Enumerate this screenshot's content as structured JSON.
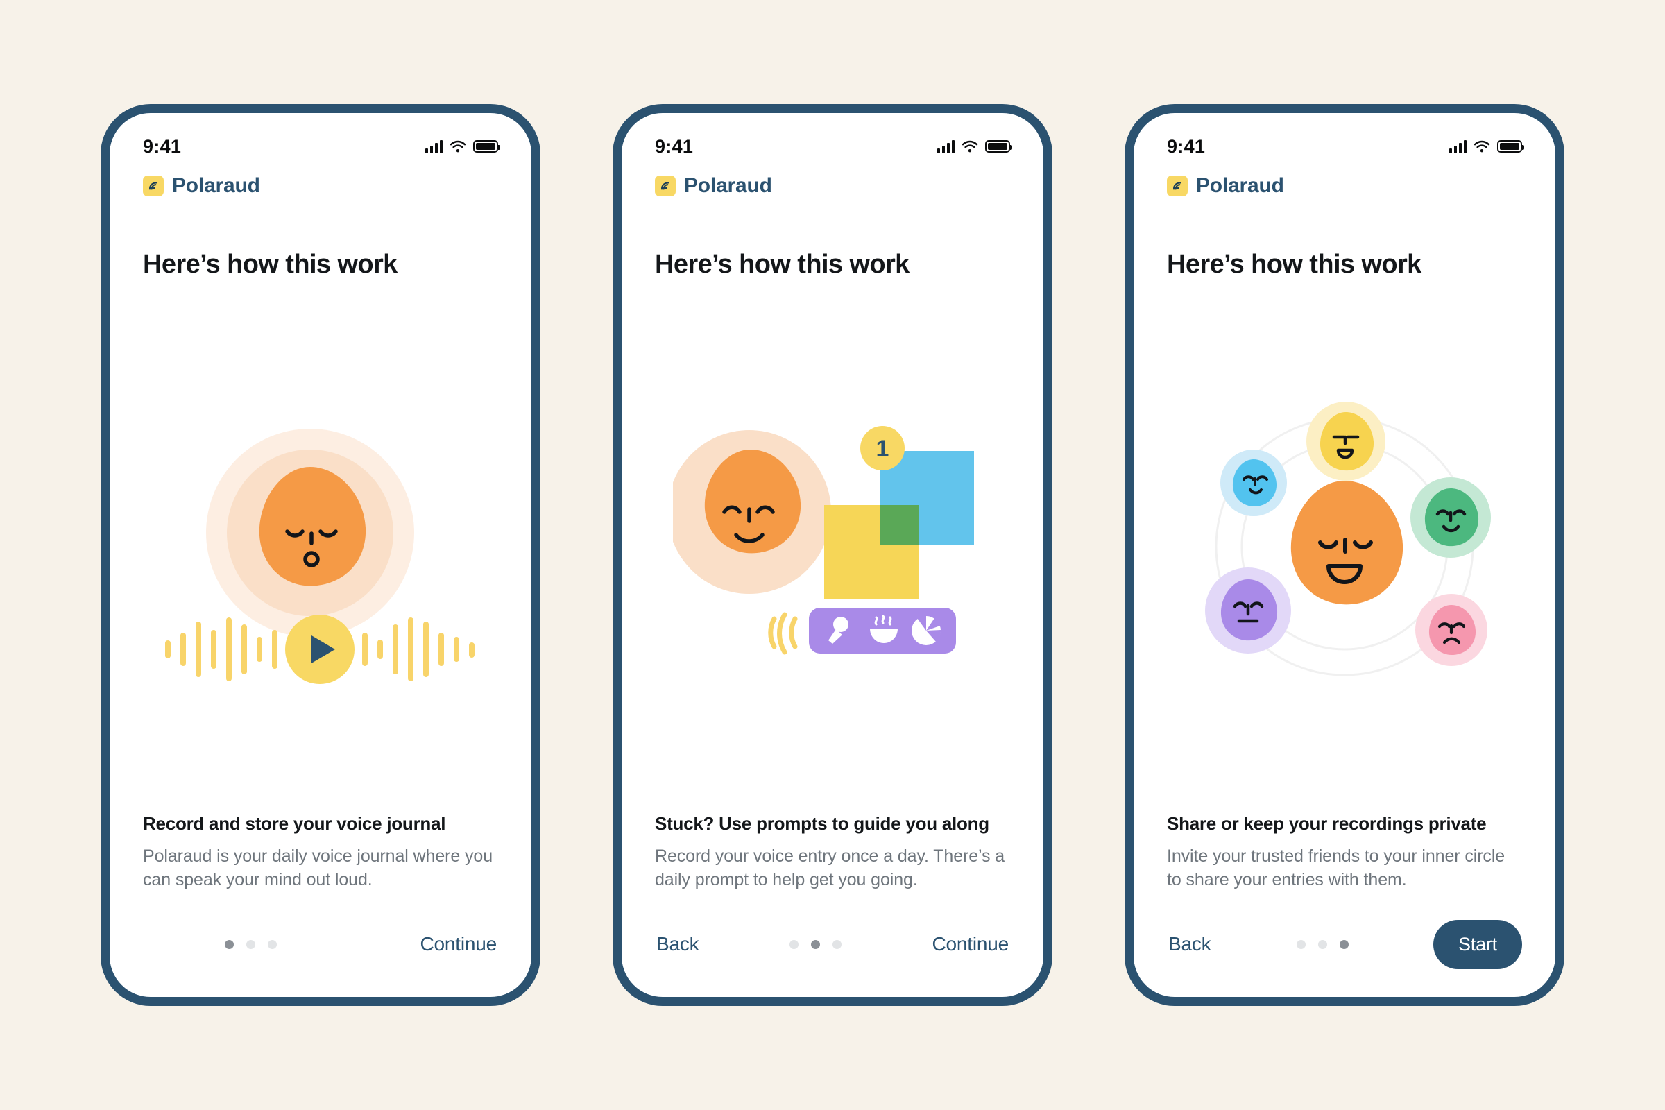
{
  "page": {
    "background_color": "#f7f2e9",
    "phone_frame_color": "#2b5270"
  },
  "status_bar": {
    "time": "9:41",
    "signal_icon": "cellular-signal-icon",
    "wifi_icon": "wifi-icon",
    "battery_icon": "battery-full-icon"
  },
  "brand": {
    "name": "Polaraud",
    "logo_icon": "polaraud-wave-logo-icon",
    "logo_bg_color": "#f8d864",
    "name_color": "#2b5270"
  },
  "screens": [
    {
      "headline": "Here’s how this work",
      "caption_title": "Record and store your voice journal",
      "caption_body": "Polaraud is your daily voice journal where you can speak your mind out loud.",
      "illustration": "voice-journal-play-illustration",
      "back_label": "",
      "next_label": "Continue",
      "next_style": "link",
      "active_dot": 0,
      "dot_count": 3
    },
    {
      "headline": "Here’s how this work",
      "caption_title": "Stuck? Use prompts to guide you along",
      "caption_body": "Record your voice entry once a day. There’s a daily prompt to help get you going.",
      "illustration": "daily-prompt-cards-illustration",
      "back_label": "Back",
      "next_label": "Continue",
      "next_style": "link",
      "active_dot": 1,
      "dot_count": 3,
      "badge_number": "1",
      "prompt_icons": [
        "microphone-icon",
        "steaming-bowl-icon",
        "beach-ball-icon"
      ]
    },
    {
      "headline": "Here’s how this work",
      "caption_title": "Share or keep your recordings private",
      "caption_body": "Invite your trusted friends to your inner circle to share your entries with them.",
      "illustration": "inner-circle-friends-illustration",
      "back_label": "Back",
      "next_label": "Start",
      "next_style": "filled",
      "active_dot": 2,
      "dot_count": 3
    }
  ],
  "colors": {
    "orange_blob": "#f59a46",
    "halo_outer": "#fdeee2",
    "halo_inner": "#fadfc8",
    "yellow": "#f8d864",
    "play_triangle": "#2b5270",
    "waveform": "#f8d46a",
    "card_yellow": "#f6d657",
    "card_blue": "#62c4ec",
    "card_overlap_green": "#5aa857",
    "pill_purple": "#a98ae8",
    "friend_yellow": "#f7d34f",
    "friend_blue": "#52c3ef",
    "friend_green": "#4cb87f",
    "friend_purple": "#a98ae8",
    "friend_pink": "#f597ae",
    "caption_body": "#6e757c",
    "dot_inactive": "#e2e4e6",
    "dot_active": "#8b9096"
  }
}
